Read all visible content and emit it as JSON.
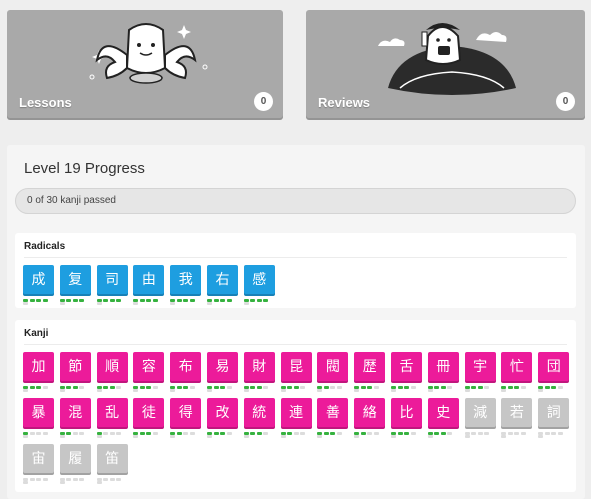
{
  "lessons": {
    "label": "Lessons",
    "count": "0"
  },
  "reviews": {
    "label": "Reviews",
    "count": "0"
  },
  "level_progress": {
    "title": "Level 19 Progress",
    "bar_text": "0 of 30 kanji passed",
    "passed_fraction": 0
  },
  "radicals": {
    "title": "Radicals",
    "items": [
      {
        "char": "成",
        "srs": 4
      },
      {
        "char": "复",
        "srs": 4
      },
      {
        "char": "司",
        "srs": 4
      },
      {
        "char": "由",
        "srs": 4
      },
      {
        "char": "我",
        "srs": 4
      },
      {
        "char": "右",
        "srs": 4
      },
      {
        "char": "感",
        "srs": 4
      }
    ]
  },
  "kanji": {
    "title": "Kanji",
    "items": [
      {
        "char": "加",
        "srs": 3,
        "locked": false
      },
      {
        "char": "節",
        "srs": 3,
        "locked": false
      },
      {
        "char": "順",
        "srs": 3,
        "locked": false
      },
      {
        "char": "容",
        "srs": 3,
        "locked": false
      },
      {
        "char": "布",
        "srs": 3,
        "locked": false
      },
      {
        "char": "易",
        "srs": 3,
        "locked": false
      },
      {
        "char": "財",
        "srs": 3,
        "locked": false
      },
      {
        "char": "昆",
        "srs": 3,
        "locked": false
      },
      {
        "char": "閥",
        "srs": 2,
        "locked": false
      },
      {
        "char": "歴",
        "srs": 3,
        "locked": false
      },
      {
        "char": "舌",
        "srs": 3,
        "locked": false
      },
      {
        "char": "冊",
        "srs": 3,
        "locked": false
      },
      {
        "char": "宇",
        "srs": 3,
        "locked": false
      },
      {
        "char": "忙",
        "srs": 3,
        "locked": false
      },
      {
        "char": "団",
        "srs": 3,
        "locked": false
      },
      {
        "char": "暴",
        "srs": 1,
        "locked": false
      },
      {
        "char": "混",
        "srs": 2,
        "locked": false
      },
      {
        "char": "乱",
        "srs": 1,
        "locked": false
      },
      {
        "char": "徒",
        "srs": 3,
        "locked": false
      },
      {
        "char": "得",
        "srs": 2,
        "locked": false
      },
      {
        "char": "改",
        "srs": 3,
        "locked": false
      },
      {
        "char": "統",
        "srs": 3,
        "locked": false
      },
      {
        "char": "連",
        "srs": 2,
        "locked": false
      },
      {
        "char": "善",
        "srs": 3,
        "locked": false
      },
      {
        "char": "絡",
        "srs": 2,
        "locked": false
      },
      {
        "char": "比",
        "srs": 3,
        "locked": false
      },
      {
        "char": "史",
        "srs": 3,
        "locked": false
      },
      {
        "char": "減",
        "srs": 0,
        "locked": true
      },
      {
        "char": "若",
        "srs": 0,
        "locked": true
      },
      {
        "char": "詞",
        "srs": 0,
        "locked": true
      },
      {
        "char": "宙",
        "srs": 0,
        "locked": true
      },
      {
        "char": "履",
        "srs": 0,
        "locked": true
      },
      {
        "char": "笛",
        "srs": 0,
        "locked": true
      }
    ]
  },
  "colors": {
    "radical": "#1e9ee0",
    "kanji": "#ec1b9a",
    "locked": "#c6c6c6",
    "srs_on": "#36b23f",
    "card": "#a9a9a9"
  }
}
